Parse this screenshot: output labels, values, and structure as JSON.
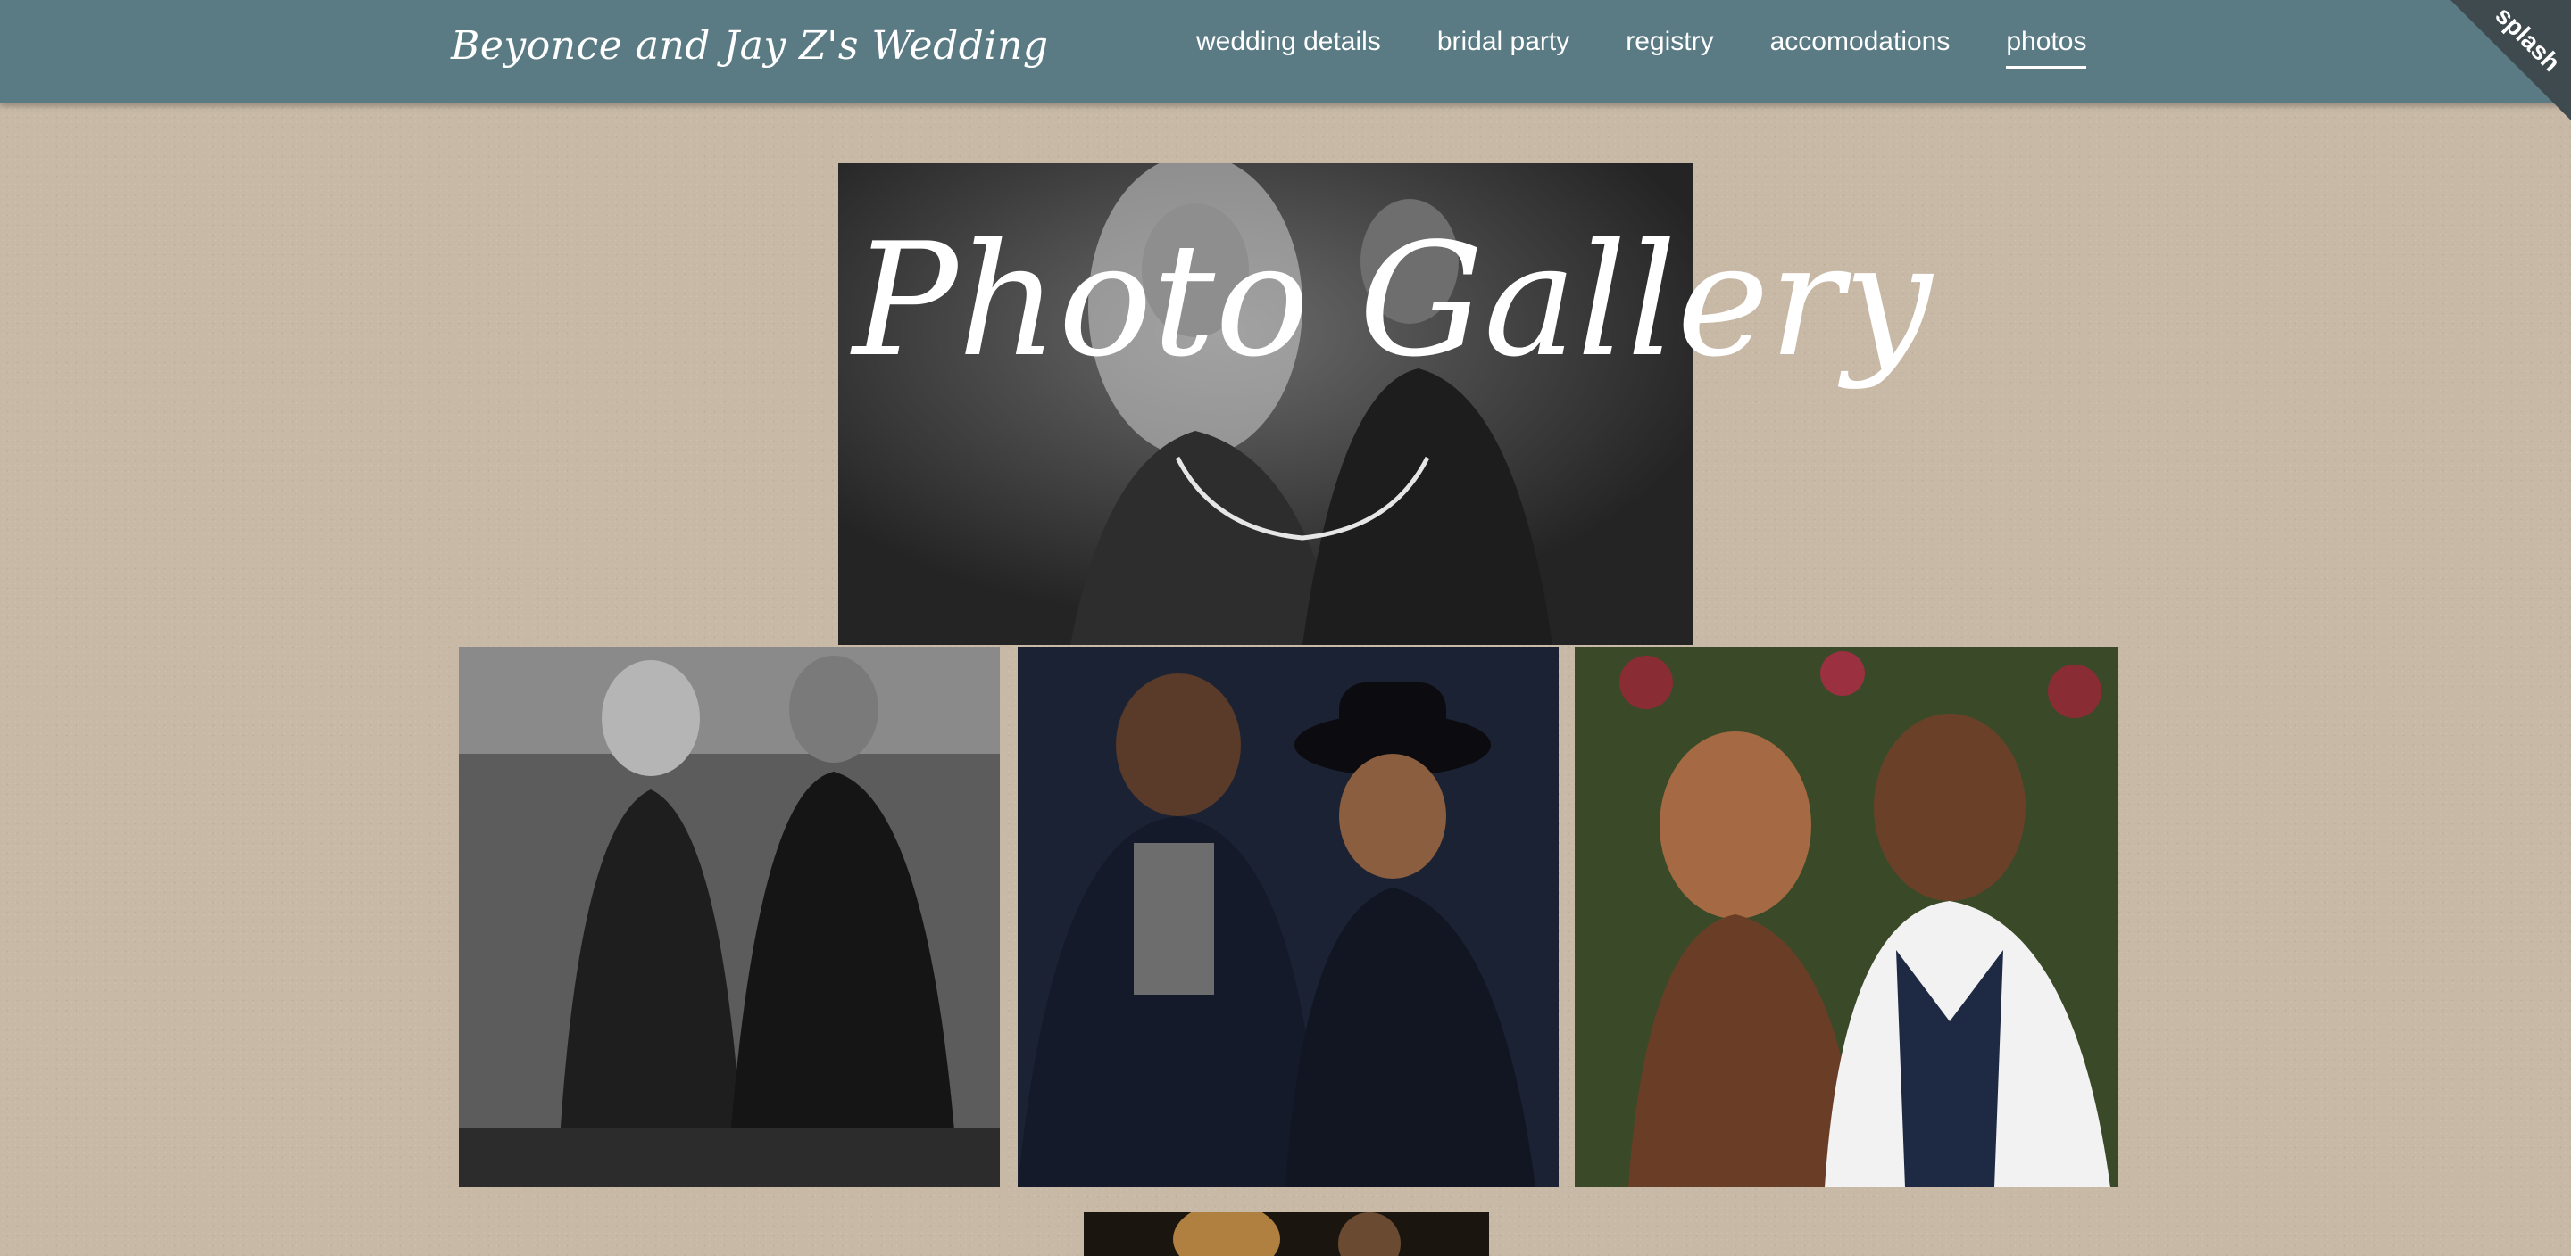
{
  "header": {
    "brand": "Beyonce and Jay Z's Wedding",
    "nav": [
      {
        "label": "wedding details"
      },
      {
        "label": "bridal party"
      },
      {
        "label": "registry"
      },
      {
        "label": "accomodations"
      },
      {
        "label": "photos",
        "active": true
      }
    ],
    "ribbon_label": "splash"
  },
  "gallery": {
    "title": "Photo Gallery"
  },
  "colors": {
    "header_bg": "#5a7a84",
    "ribbon_bg": "#3f4a4f",
    "page_bg": "#c8b9a6"
  }
}
